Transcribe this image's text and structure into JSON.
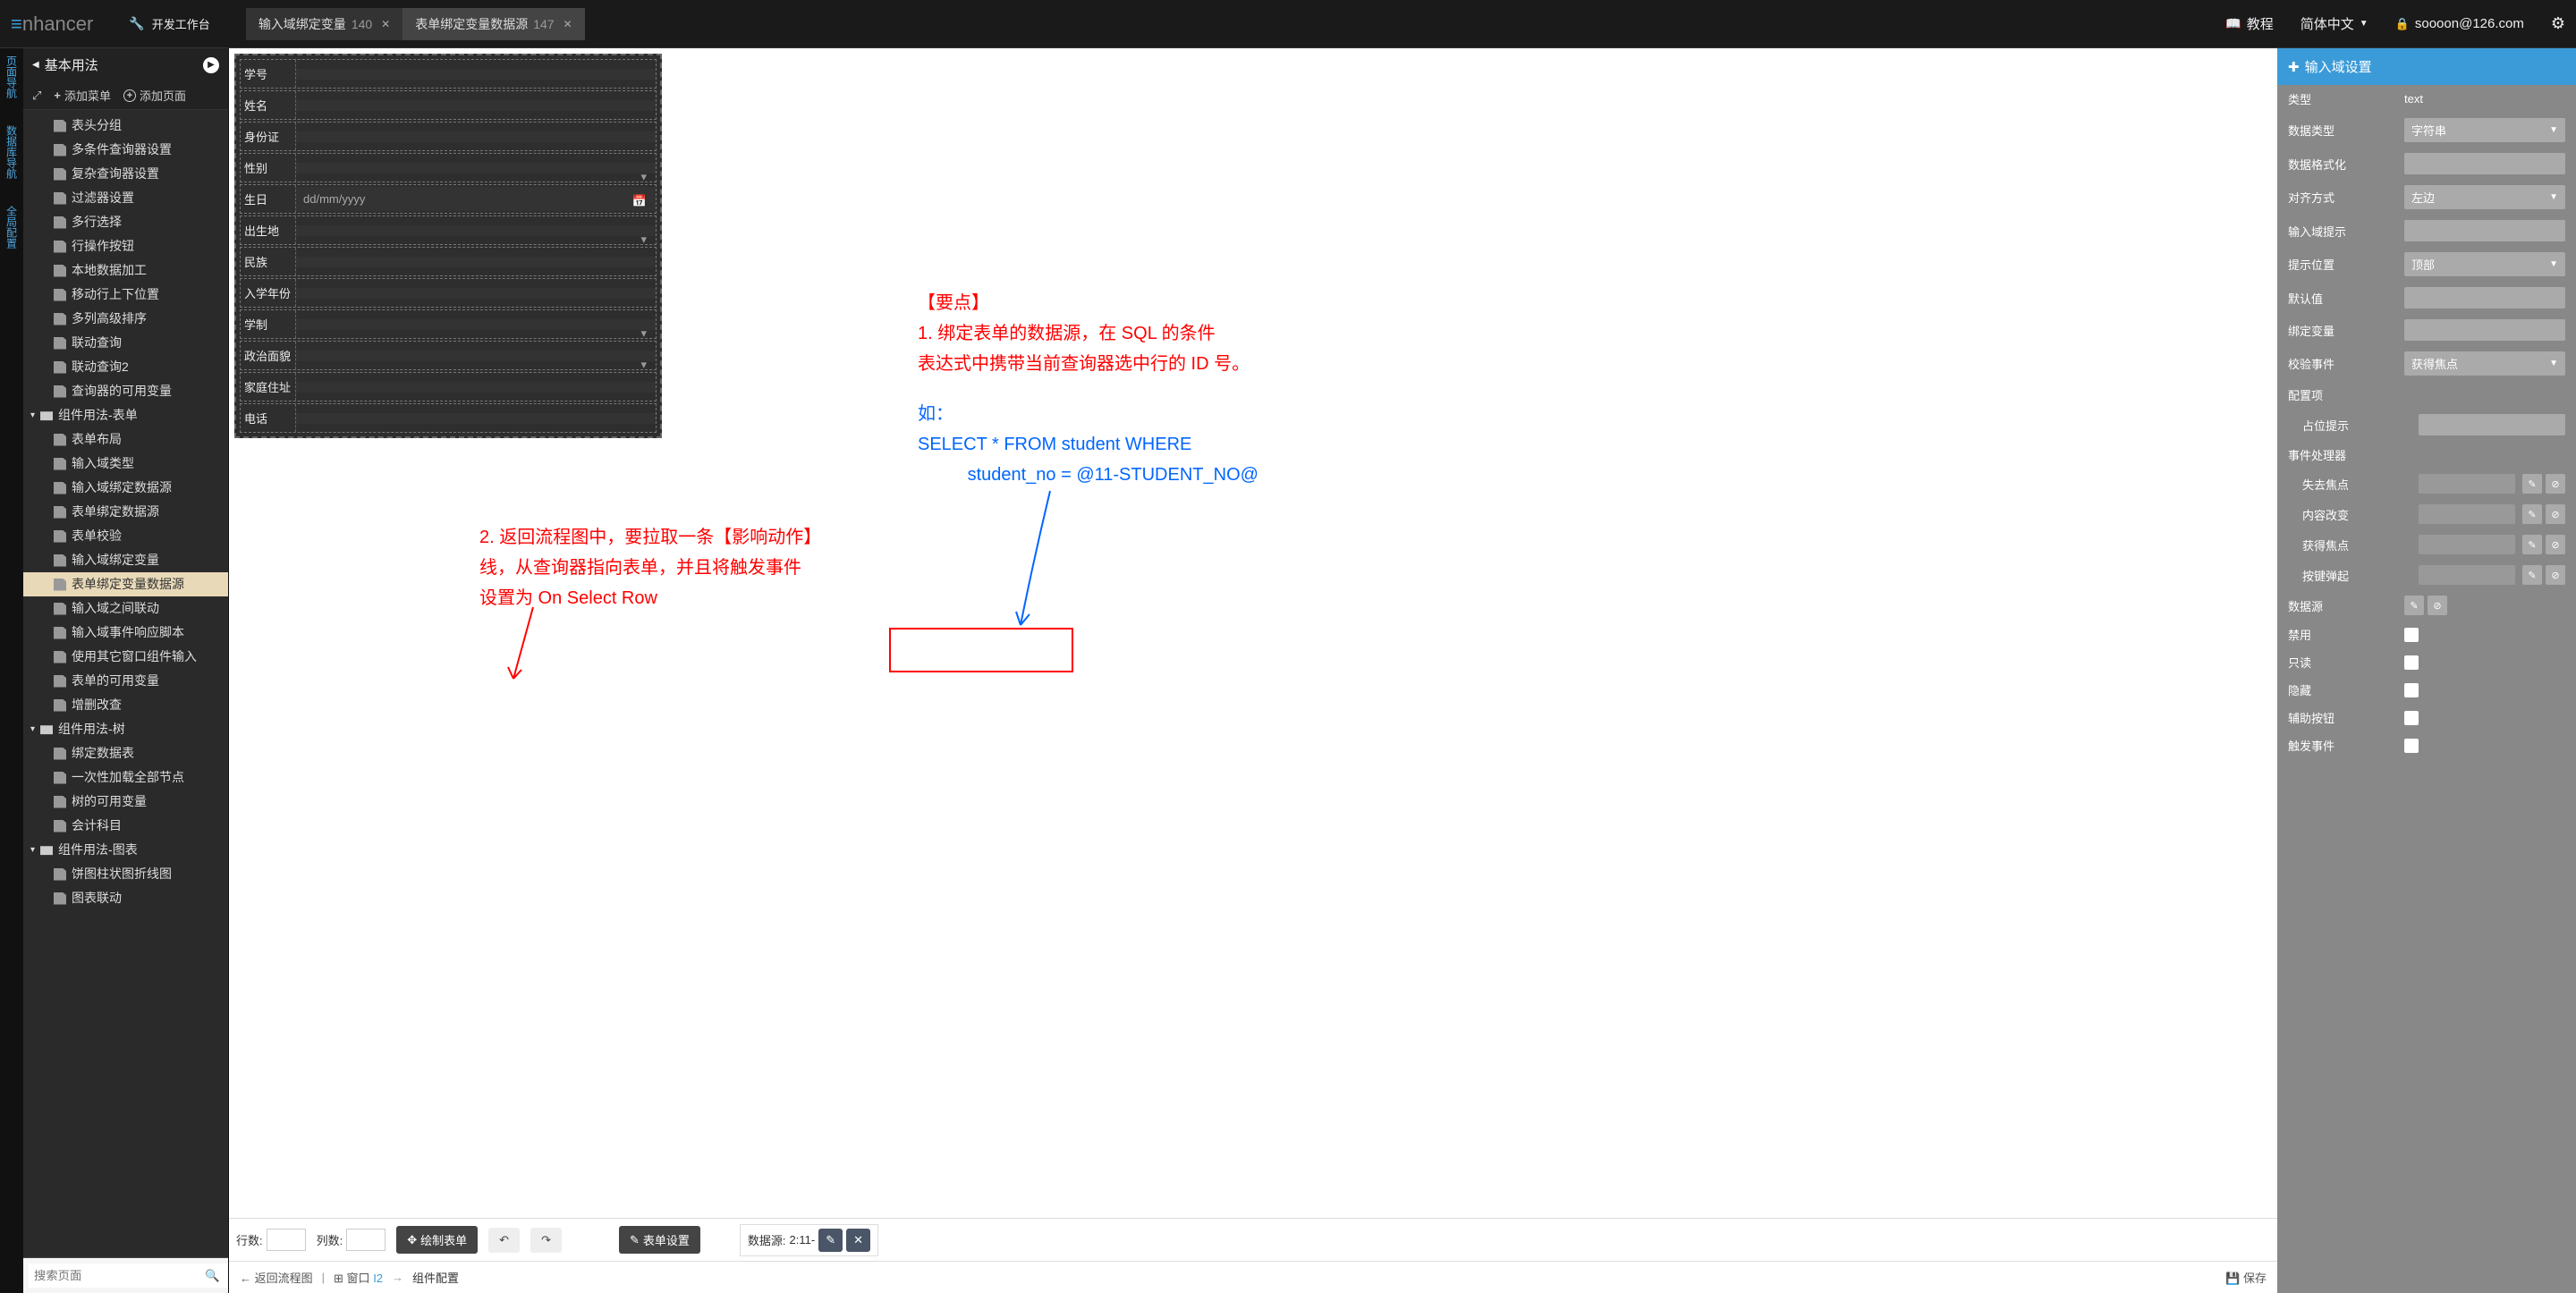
{
  "top": {
    "logo": "nhancer",
    "workspace": "开发工作台",
    "tabs": [
      {
        "label": "输入域绑定变量",
        "num": "140"
      },
      {
        "label": "表单绑定变量数据源",
        "num": "147"
      }
    ],
    "tutorial": "教程",
    "lang": "简体中文",
    "user": "soooon@126.com"
  },
  "leftrail": [
    "页面导航",
    "数据库导航",
    "全局配置"
  ],
  "side": {
    "title": "基本用法",
    "add_menu": "添加菜单",
    "add_page": "添加页面",
    "search_ph": "搜索页面",
    "items": [
      {
        "t": "表头分组",
        "k": "file"
      },
      {
        "t": "多条件查询器设置",
        "k": "file"
      },
      {
        "t": "复杂查询器设置",
        "k": "file"
      },
      {
        "t": "过滤器设置",
        "k": "file"
      },
      {
        "t": "多行选择",
        "k": "file"
      },
      {
        "t": "行操作按钮",
        "k": "file"
      },
      {
        "t": "本地数据加工",
        "k": "file"
      },
      {
        "t": "移动行上下位置",
        "k": "file"
      },
      {
        "t": "多列高级排序",
        "k": "file"
      },
      {
        "t": "联动查询",
        "k": "file"
      },
      {
        "t": "联动查询2",
        "k": "file"
      },
      {
        "t": "查询器的可用变量",
        "k": "file"
      },
      {
        "t": "组件用法-表单",
        "k": "fold",
        "g": true
      },
      {
        "t": "表单布局",
        "k": "file"
      },
      {
        "t": "输入域类型",
        "k": "file"
      },
      {
        "t": "输入域绑定数据源",
        "k": "file"
      },
      {
        "t": "表单绑定数据源",
        "k": "file"
      },
      {
        "t": "表单校验",
        "k": "file"
      },
      {
        "t": "输入域绑定变量",
        "k": "file"
      },
      {
        "t": "表单绑定变量数据源",
        "k": "file",
        "active": true
      },
      {
        "t": "输入域之间联动",
        "k": "file"
      },
      {
        "t": "输入域事件响应脚本",
        "k": "file"
      },
      {
        "t": "使用其它窗口组件输入",
        "k": "file"
      },
      {
        "t": "表单的可用变量",
        "k": "file"
      },
      {
        "t": "增删改查",
        "k": "file"
      },
      {
        "t": "组件用法-树",
        "k": "fold",
        "g": true
      },
      {
        "t": "绑定数据表",
        "k": "file"
      },
      {
        "t": "一次性加载全部节点",
        "k": "file"
      },
      {
        "t": "树的可用变量",
        "k": "file"
      },
      {
        "t": "会计科目",
        "k": "file"
      },
      {
        "t": "组件用法-图表",
        "k": "fold",
        "g": true
      },
      {
        "t": "饼图柱状图折线图",
        "k": "file"
      },
      {
        "t": "图表联动",
        "k": "file"
      }
    ]
  },
  "form_fields": [
    {
      "label": "学号"
    },
    {
      "label": "姓名"
    },
    {
      "label": "身份证"
    },
    {
      "label": "性别",
      "dd": true
    },
    {
      "label": "生日",
      "ph": "dd/mm/yyyy",
      "cal": true
    },
    {
      "label": "出生地",
      "dd": true
    },
    {
      "label": "民族"
    },
    {
      "label": "入学年份"
    },
    {
      "label": "学制",
      "dd": true
    },
    {
      "label": "政治面貌",
      "dd": true
    },
    {
      "label": "家庭住址"
    },
    {
      "label": "电话"
    }
  ],
  "annot": {
    "p1_title": "【要点】",
    "p1_l1": "1. 绑定表单的数据源，在 SQL 的条件",
    "p1_l2": "表达式中携带当前查询器选中行的 ID 号。",
    "p2_l1": "如：",
    "p2_l2": "SELECT * FROM student WHERE",
    "p2_l3": "          student_no = @11-STUDENT_NO@",
    "p3_l1": "2. 返回流程图中，要拉取一条【影响动作】",
    "p3_l2": "线，从查询器指向表单，并且将触发事件",
    "p3_l3": "设置为 On Select Row"
  },
  "bottom": {
    "rows": "行数:",
    "cols": "列数:",
    "draw": "绘制表单",
    "form_set": "表单设置",
    "ds_label": "数据源:",
    "ds_val": "2:11-"
  },
  "crumb": {
    "back": "返回流程图",
    "grid": "窗口",
    "wid": "I2",
    "comp": "组件配置",
    "save": "保存"
  },
  "rp": {
    "title": "输入域设置",
    "rows": [
      {
        "l": "类型",
        "v": "text",
        "ty": "text"
      },
      {
        "l": "数据类型",
        "v": "字符串",
        "ty": "sel"
      },
      {
        "l": "数据格式化",
        "ty": "inp"
      },
      {
        "l": "对齐方式",
        "v": "左边",
        "ty": "sel"
      },
      {
        "l": "输入域提示",
        "ty": "inp"
      },
      {
        "l": "提示位置",
        "v": "顶部",
        "ty": "sel"
      },
      {
        "l": "默认值",
        "ty": "inp"
      },
      {
        "l": "绑定变量",
        "ty": "inp"
      },
      {
        "l": "校验事件",
        "v": "获得焦点",
        "ty": "sel"
      }
    ],
    "cfg": "配置项",
    "cfg_items": [
      {
        "l": "占位提示",
        "ty": "inp"
      }
    ],
    "evt_hdr": "事件处理器",
    "events": [
      "失去焦点",
      "内容改变",
      "获得焦点",
      "按键弹起"
    ],
    "ds": "数据源",
    "checks": [
      "禁用",
      "只读",
      "隐藏",
      "辅助按钮",
      "触发事件"
    ]
  }
}
